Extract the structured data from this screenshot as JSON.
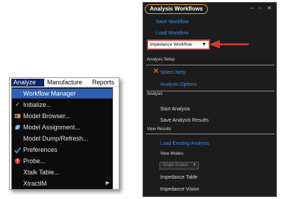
{
  "menu": {
    "menubar": {
      "analyze": "Analyze",
      "manufacture": "Manufacture",
      "reports": "Reports"
    },
    "items": [
      {
        "label": "Workflow Manager",
        "icon": "none"
      },
      {
        "label": "Initialize...",
        "icon": "check-icon"
      },
      {
        "label": "Model Browser...",
        "icon": "model-browser-icon"
      },
      {
        "label": "Model Assignment...",
        "icon": "model-assignment-icon"
      },
      {
        "label": "Model Dump/Refresh...",
        "icon": "none"
      },
      {
        "label": "Preferences",
        "icon": "preferences-icon"
      },
      {
        "label": "Probe...",
        "icon": "probe-icon"
      },
      {
        "label": "Xtalk Table...",
        "icon": "none"
      },
      {
        "label": "XtractIM",
        "icon": "submenu-arrow-icon"
      }
    ],
    "highlight_color": "#2f5fb8"
  },
  "panel": {
    "title": "Analysis Workflows",
    "title_outline_color": "#e8a62b",
    "header_buttons": [
      "pin",
      "restore",
      "close"
    ],
    "save_workflow": "Save Workflow",
    "load_workflow": "Load Workflow",
    "workflow_select": {
      "value": "Impedance Workflow"
    },
    "annotation_color": "#d43a2a",
    "sections": {
      "analysis_setup": "Analysis Setup",
      "select_nets": "Select Nets",
      "analysis_options": "Analysis Options",
      "analysis": "Analysis",
      "start_analysis": "Start Analysis",
      "save_analysis_results": "Save Analysis Results",
      "view_results": "View Results",
      "load_existing_analysis": "Load Existing Analysis",
      "view_modes": "View Modes:",
      "view_mode_value": "Single Ended",
      "impedance_table": "Impedance Table",
      "impedance_vision": "Impedance Vision"
    },
    "link_color": "#3a8ee6"
  }
}
